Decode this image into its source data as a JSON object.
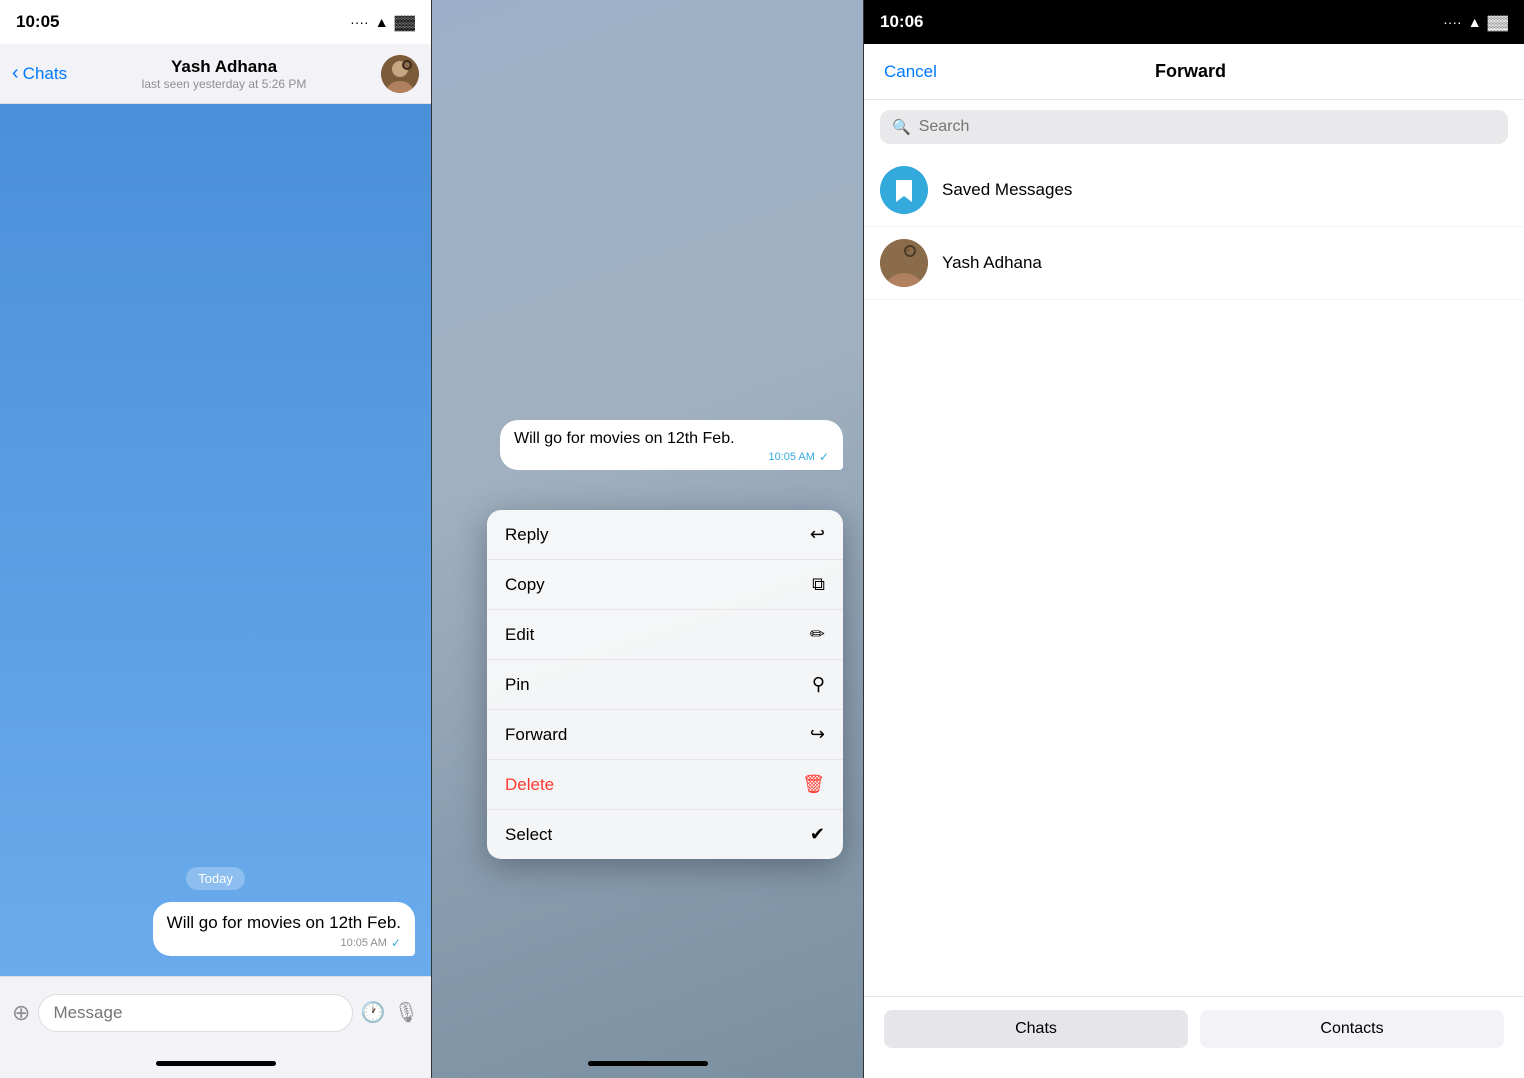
{
  "panel1": {
    "status_time": "10:05",
    "status_signal": "···",
    "status_wifi": "WiFi",
    "status_battery": "🔋",
    "back_label": "Chats",
    "user_name": "Yash Adhana",
    "user_status": "last seen yesterday at 5:26 PM",
    "date_badge": "Today",
    "message_text": "Will go for movies on 12th Feb.",
    "message_time": "10:05 AM",
    "message_tick": "✓",
    "input_placeholder": "Message",
    "attach_icon": "📎",
    "emoji_icon": "😊",
    "voice_icon": "🎙"
  },
  "panel2": {
    "message_text": "Will go for movies on 12th Feb.",
    "message_time": "10:05 AM",
    "menu_items": [
      {
        "label": "Reply",
        "icon": "↩",
        "color": "normal"
      },
      {
        "label": "Copy",
        "icon": "⧉",
        "color": "normal"
      },
      {
        "label": "Edit",
        "icon": "✏",
        "color": "normal"
      },
      {
        "label": "Pin",
        "icon": "📌",
        "color": "normal"
      },
      {
        "label": "Forward",
        "icon": "↪",
        "color": "normal"
      },
      {
        "label": "Delete",
        "icon": "🗑",
        "color": "delete"
      },
      {
        "label": "Select",
        "icon": "✔",
        "color": "normal"
      }
    ]
  },
  "panel3": {
    "status_time": "10:06",
    "status_signal": "···",
    "status_wifi": "WiFi",
    "status_battery": "🔋",
    "cancel_label": "Cancel",
    "title": "Forward",
    "search_placeholder": "Search",
    "contacts": [
      {
        "name": "Saved Messages",
        "type": "saved"
      },
      {
        "name": "Yash Adhana",
        "type": "user"
      }
    ],
    "tabs": [
      {
        "label": "Chats",
        "active": true
      },
      {
        "label": "Contacts",
        "active": false
      }
    ]
  }
}
